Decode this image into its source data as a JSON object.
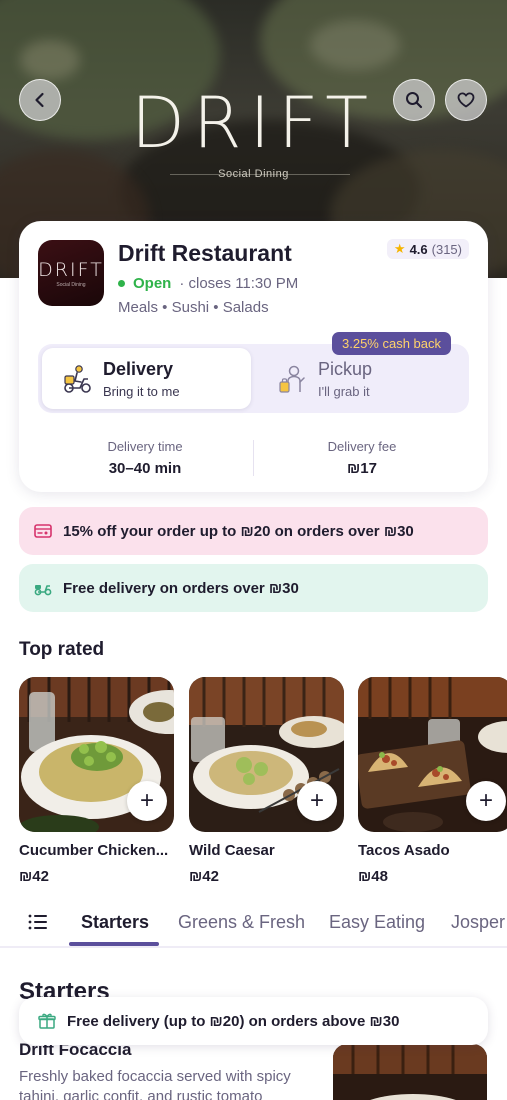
{
  "hero": {
    "logo_text": "DRIFT",
    "logo_subtitle": "Social Dining",
    "back_icon": "chevron-left-icon",
    "search_icon": "search-icon",
    "favorite_icon": "heart-icon"
  },
  "restaurant": {
    "logo_text": "DRIFT",
    "logo_subtitle": "Social Dining",
    "name": "Drift Restaurant",
    "rating": "4.6",
    "review_count": "(315)",
    "status": "Open",
    "closes": "· closes 11:30 PM",
    "cuisines": "Meals • Sushi • Salads"
  },
  "order_mode": {
    "cashback_badge": "3.25% cash back",
    "options": [
      {
        "title": "Delivery",
        "subtitle": "Bring it to me",
        "icon": "scooter-icon",
        "selected": true
      },
      {
        "title": "Pickup",
        "subtitle": "I'll grab it",
        "icon": "pickup-bag-icon",
        "selected": false
      }
    ]
  },
  "fees": {
    "delivery_time_label": "Delivery time",
    "delivery_time_value": "30–40 min",
    "delivery_fee_label": "Delivery fee",
    "delivery_fee_value": "₪17"
  },
  "promos": [
    {
      "text": "15% off your order up to ₪20 on orders over ₪30",
      "icon": "coupon-icon",
      "color": "#fbe1ec"
    },
    {
      "text": "Free delivery on orders over ₪30",
      "icon": "scooter-icon",
      "color": "#e2f5ee"
    }
  ],
  "top_rated": {
    "title": "Top rated",
    "items": [
      {
        "name": "Cucumber Chicken...",
        "price": "₪42"
      },
      {
        "name": "Wild Caesar",
        "price": "₪42"
      },
      {
        "name": "Tacos Asado",
        "price": "₪48"
      }
    ]
  },
  "tabs": {
    "menu_icon": "list-icon",
    "items": [
      "Starters",
      "Greens & Fresh",
      "Easy Eating",
      "Josper"
    ],
    "active": "Starters"
  },
  "menu": {
    "section_title": "Starters",
    "dish_name": "Drift Focaccia",
    "dish_description": "Freshly baked focaccia served with spicy tahini, garlic confit, and rustic tomato"
  },
  "banner": {
    "text": "Free delivery (up to ₪20) on orders above ₪30",
    "icon": "gift-icon"
  },
  "colors": {
    "accent": "#5b4f9c",
    "open_green": "#2fb34a",
    "cashback_text": "#ffd36a",
    "star": "#f5b400"
  }
}
